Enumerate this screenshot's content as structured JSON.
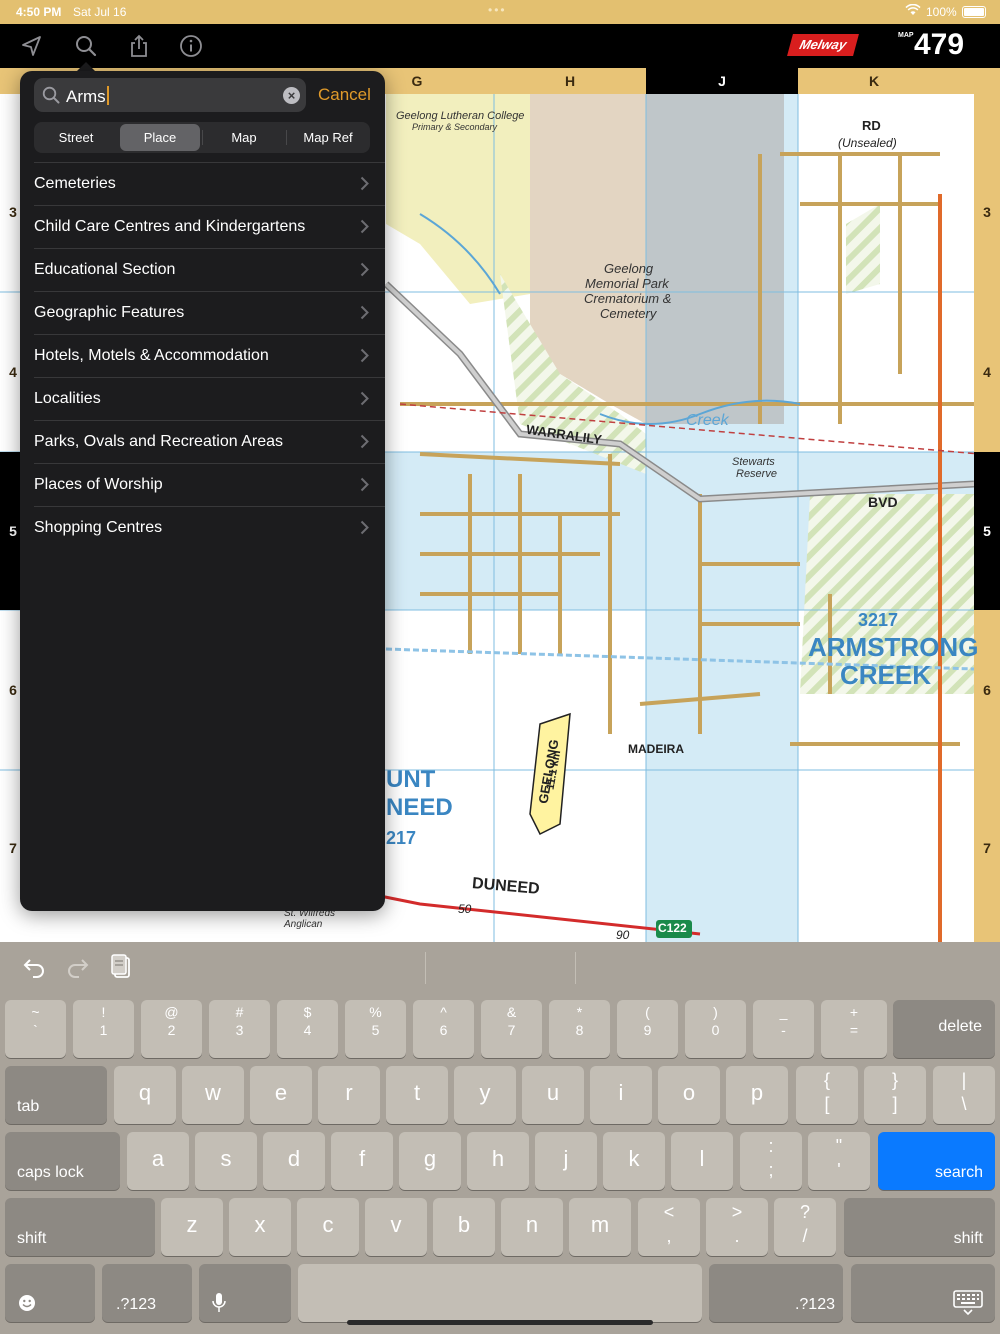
{
  "status_bar": {
    "time": "4:50 PM",
    "date": "Sat Jul 16",
    "battery": "100%"
  },
  "toolbar": {
    "brand": "Melway",
    "map_label": "MAP",
    "map_number": "479"
  },
  "map": {
    "columns": [
      "G",
      "H",
      "J",
      "K"
    ],
    "active_column": "J",
    "rows": [
      "3",
      "4",
      "5",
      "6",
      "7"
    ],
    "active_row": "5",
    "labels": {
      "college": "Geelong Lutheran College",
      "college_sub": "Primary & Secondary",
      "cemetery_1": "Geelong",
      "cemetery_2": "Memorial Park",
      "cemetery_3": "Crematorium &",
      "cemetery_4": "Cemetery",
      "suburb_code": "3217",
      "suburb_1": "ARMSTRONG",
      "suburb_2": "CREEK",
      "reserve_1": "Stewarts",
      "reserve_2": "Reserve",
      "road_warralily": "WARRALILY",
      "road_bvd": "BVD",
      "road_duneed": "DUNEED",
      "road_rd": "RD",
      "road_unsealed": "(Unsealed)",
      "road_madeira": "MADEIRA",
      "road_creek": "Creek",
      "road_c122": "C122",
      "sign_geelong": "GEELONG",
      "sign_km": "11.1 km",
      "mount_duneed_1": "UNT",
      "mount_duneed_2": "NEED",
      "mount_duneed_3": "217",
      "anglican": "St. Wilfreds Anglican",
      "speed_50": "50",
      "speed_90": "90"
    }
  },
  "search": {
    "query": "Arms",
    "cancel_label": "Cancel",
    "segments": [
      "Street",
      "Place",
      "Map",
      "Map Ref"
    ],
    "selected_segment": "Place",
    "categories": [
      "Cemeteries",
      "Child Care Centres and Kindergartens",
      "Educational Section",
      "Geographic Features",
      "Hotels, Motels & Accommodation",
      "Localities",
      "Parks, Ovals and Recreation Areas",
      "Places of Worship",
      "Shopping Centres"
    ]
  },
  "keyboard": {
    "row1": [
      {
        "top": "~",
        "bot": "`"
      },
      {
        "top": "!",
        "bot": "1"
      },
      {
        "top": "@",
        "bot": "2"
      },
      {
        "top": "#",
        "bot": "3"
      },
      {
        "top": "$",
        "bot": "4"
      },
      {
        "top": "%",
        "bot": "5"
      },
      {
        "top": "^",
        "bot": "6"
      },
      {
        "top": "&",
        "bot": "7"
      },
      {
        "top": "*",
        "bot": "8"
      },
      {
        "top": "(",
        "bot": "9"
      },
      {
        "top": ")",
        "bot": "0"
      },
      {
        "top": "_",
        "bot": "-"
      },
      {
        "top": "+",
        "bot": "="
      }
    ],
    "delete": "delete",
    "tab": "tab",
    "row2": [
      "q",
      "w",
      "e",
      "r",
      "t",
      "y",
      "u",
      "i",
      "o",
      "p"
    ],
    "row2_extra": [
      {
        "top": "{",
        "bot": "["
      },
      {
        "top": "}",
        "bot": "]"
      },
      {
        "top": "|",
        "bot": "\\"
      }
    ],
    "caps": "caps lock",
    "row3": [
      "a",
      "s",
      "d",
      "f",
      "g",
      "h",
      "j",
      "k",
      "l"
    ],
    "row3_extra": [
      {
        "top": ":",
        "bot": ";"
      },
      {
        "top": "\"",
        "bot": "'"
      }
    ],
    "search": "search",
    "shift": "shift",
    "row4": [
      "z",
      "x",
      "c",
      "v",
      "b",
      "n",
      "m"
    ],
    "row4_extra": [
      {
        "top": "<",
        "bot": ","
      },
      {
        "top": ">",
        "bot": "."
      },
      {
        "top": "?",
        "bot": "/"
      }
    ],
    "numbers": ".?123",
    "emoji_icon": "emoji-icon",
    "mic_icon": "microphone-icon",
    "hide_icon": "keyboard-hide-icon"
  }
}
